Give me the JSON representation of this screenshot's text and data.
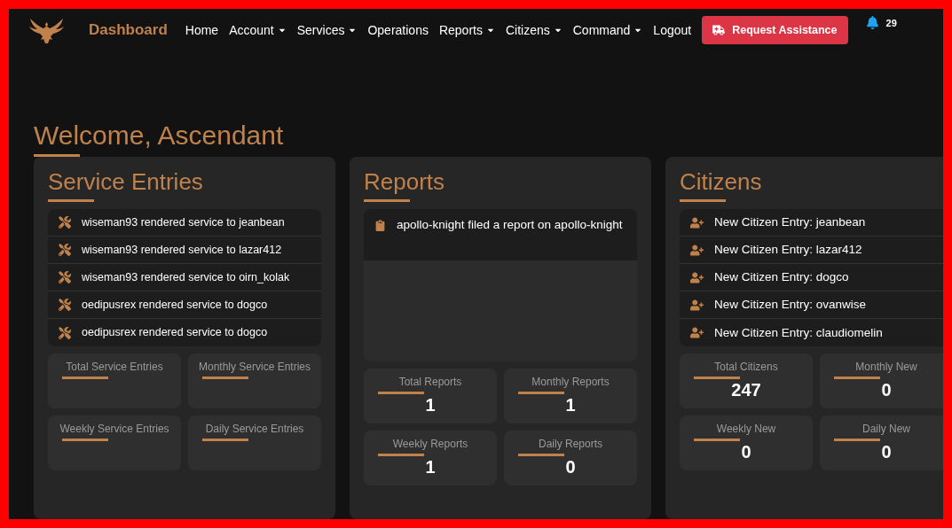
{
  "navbar": {
    "brand": "Dashboard",
    "items": [
      {
        "label": "Home",
        "dropdown": false
      },
      {
        "label": "Account",
        "dropdown": true
      },
      {
        "label": "Services",
        "dropdown": true
      },
      {
        "label": "Operations",
        "dropdown": false
      },
      {
        "label": "Reports",
        "dropdown": true
      },
      {
        "label": "Citizens",
        "dropdown": true
      },
      {
        "label": "Command",
        "dropdown": true
      },
      {
        "label": "Logout",
        "dropdown": false
      }
    ],
    "assist_button": "Request Assistance",
    "notification_count": "29"
  },
  "welcome": "Welcome, Ascendant",
  "panels": [
    {
      "title": "Service Entries",
      "kind": "service",
      "entries": [
        "wiseman93 rendered service to jeanbean",
        "wiseman93 rendered service to lazar412",
        "wiseman93 rendered service to oirn_kolak",
        "oedipusrex rendered service to dogco",
        "oedipusrex rendered service to dogco"
      ],
      "stats": [
        {
          "label": "Total Service Entries"
        },
        {
          "label": "Monthly Service Entries"
        },
        {
          "label": "Weekly Service Entries"
        },
        {
          "label": "Daily Service Entries"
        }
      ]
    },
    {
      "title": "Reports",
      "kind": "report",
      "entries": [
        "apollo-knight filed a report on apollo-knight"
      ],
      "stats": [
        {
          "label": "Total Reports",
          "value": "1"
        },
        {
          "label": "Monthly Reports",
          "value": "1"
        },
        {
          "label": "Weekly Reports",
          "value": "1"
        },
        {
          "label": "Daily Reports",
          "value": "0"
        }
      ]
    },
    {
      "title": "Citizens",
      "kind": "citizen",
      "entries": [
        "New Citizen Entry: jeanbean",
        "New Citizen Entry: lazar412",
        "New Citizen Entry: dogco",
        "New Citizen Entry: ovanwise",
        "New Citizen Entry: claudiomelin"
      ],
      "stats": [
        {
          "label": "Total Citizens",
          "value": "247"
        },
        {
          "label": "Monthly New",
          "value": "0"
        },
        {
          "label": "Weekly New",
          "value": "0"
        },
        {
          "label": "Daily New",
          "value": "0"
        }
      ]
    }
  ]
}
